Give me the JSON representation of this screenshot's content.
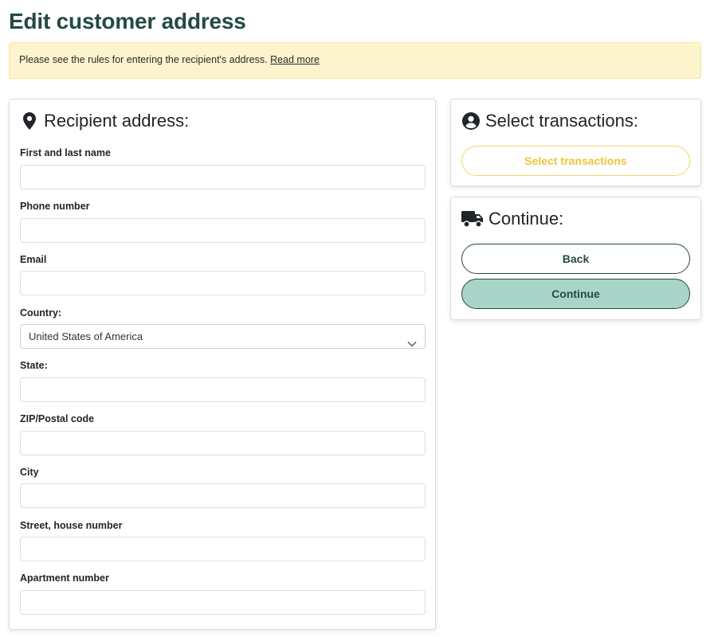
{
  "page": {
    "title": "Edit customer address"
  },
  "notice": {
    "text": "Please see the rules for entering the recipient's address.",
    "link": "Read more"
  },
  "address": {
    "title": "Recipient address:",
    "icon": "map-marker-icon",
    "fields": {
      "name": {
        "label": "First and last name",
        "value": ""
      },
      "phone": {
        "label": "Phone number",
        "value": ""
      },
      "email": {
        "label": "Email",
        "value": ""
      },
      "country": {
        "label": "Country:",
        "value": "United States of America"
      },
      "state": {
        "label": "State:",
        "value": ""
      },
      "zip": {
        "label": "ZIP/Postal code",
        "value": ""
      },
      "city": {
        "label": "City",
        "value": ""
      },
      "street": {
        "label": "Street, house number",
        "value": ""
      },
      "apartment": {
        "label": "Apartment number",
        "value": ""
      }
    }
  },
  "transactions": {
    "title": "Select transactions:",
    "icon": "user-circle-icon",
    "button": "Select transactions"
  },
  "continue_panel": {
    "title": "Continue:",
    "icon": "truck-icon",
    "back": "Back",
    "continue": "Continue"
  },
  "colors": {
    "title": "#234a44",
    "notice_bg": "#fdf3cd",
    "accent_yellow": "#f2c238",
    "continue_bg": "#a8d5c8"
  }
}
